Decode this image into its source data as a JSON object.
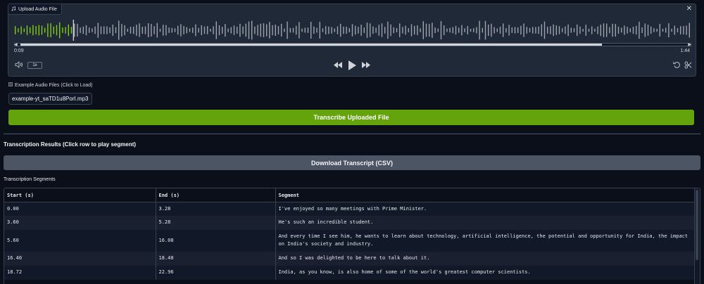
{
  "audio": {
    "label": "Upload Audio File",
    "label_icon": "music-note-icon",
    "current_time": "0:09",
    "total_time": "1:44",
    "speed": "1x",
    "progress_fraction": 0.087,
    "colors": {
      "played": "#84cc16",
      "unplayed": "#9ca3af"
    }
  },
  "examples": {
    "label": "Example Audio Files (Click to Load)",
    "items": [
      "example-yt_saTD1u8PorI.mp3"
    ]
  },
  "transcribe_button": "Transcribe Uploaded File",
  "results": {
    "title": "Transcription Results (Click row to play segment)",
    "download_button": "Download Transcript (CSV)",
    "segments_label": "Transcription Segments",
    "columns": [
      "Start (s)",
      "End (s)",
      "Segment"
    ],
    "rows": [
      [
        "0.00",
        "3.28",
        "I've enjoyed so many meetings with Prime Minister."
      ],
      [
        "3.60",
        "5.28",
        "He's such an incredible student."
      ],
      [
        "5.60",
        "16.08",
        "And every time I see him, he wants to learn about technology, artificial intelligence, the potential and opportunity for India, the impact on India's society and industry."
      ],
      [
        "16.40",
        "18.40",
        "And so I was delighted to be here to talk about it."
      ],
      [
        "18.72",
        "22.96",
        "India, as you know, is also home of some of the world's greatest computer scientists."
      ]
    ]
  },
  "colors": {
    "accent": "#65a30d",
    "secondary_button": "#4b5563",
    "background": "#0b0f19"
  }
}
